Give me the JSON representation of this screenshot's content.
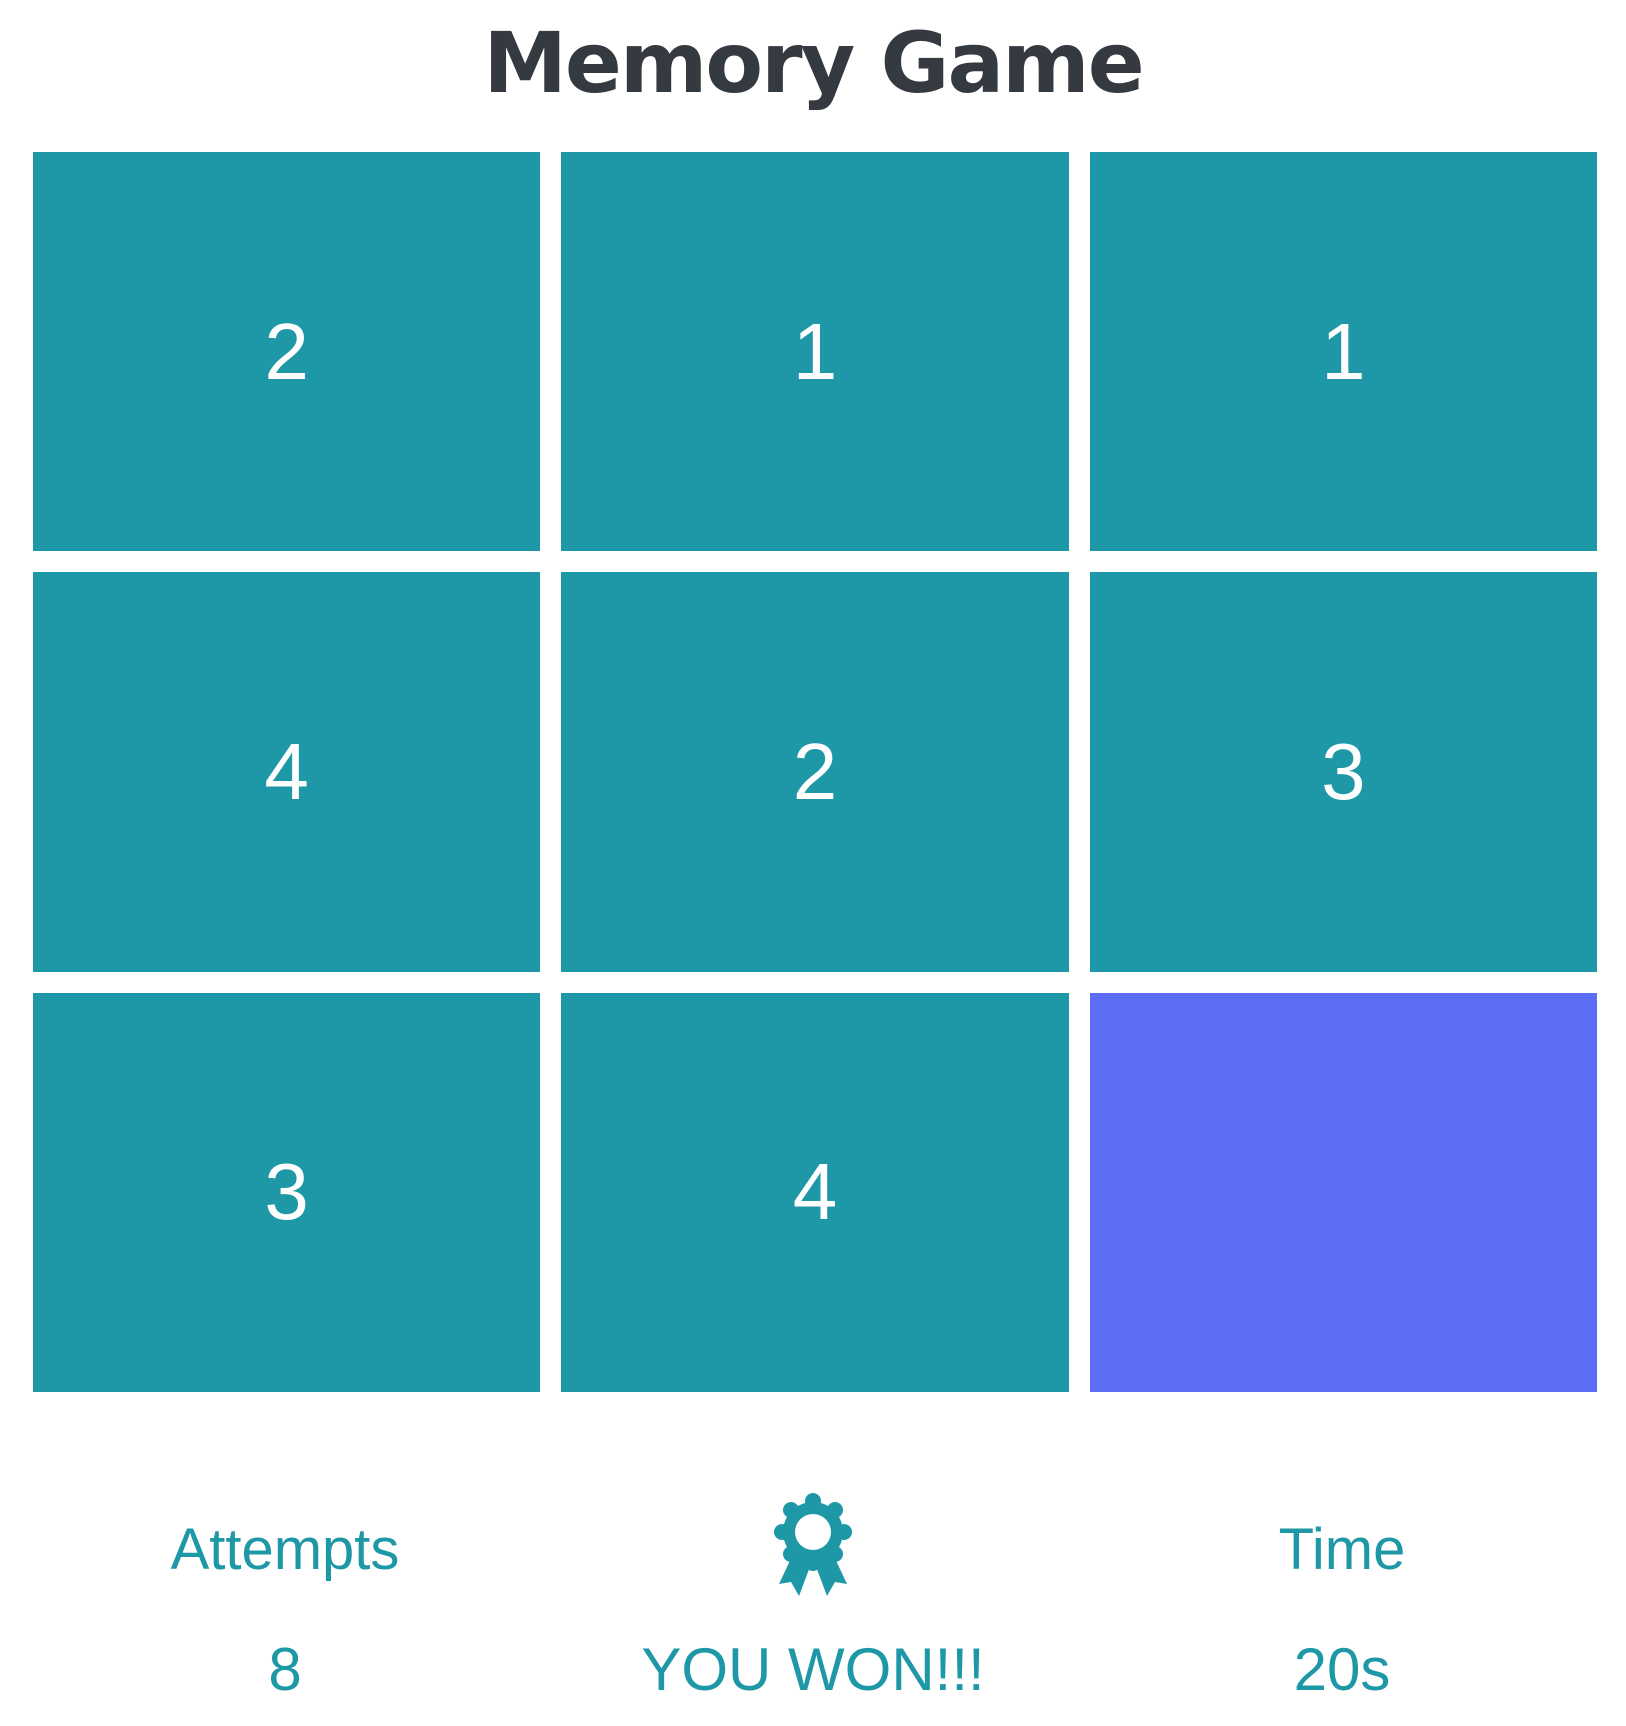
{
  "title": "Memory Game",
  "board": {
    "cards": [
      {
        "value": "2",
        "state": "revealed"
      },
      {
        "value": "1",
        "state": "revealed"
      },
      {
        "value": "1",
        "state": "revealed"
      },
      {
        "value": "4",
        "state": "revealed"
      },
      {
        "value": "2",
        "state": "revealed"
      },
      {
        "value": "3",
        "state": "revealed"
      },
      {
        "value": "3",
        "state": "revealed"
      },
      {
        "value": "4",
        "state": "revealed"
      },
      {
        "value": "",
        "state": "unrevealed"
      }
    ]
  },
  "stats": {
    "attempts_label": "Attempts",
    "attempts_value": "8",
    "status_icon": "award-icon",
    "status_text": "YOU WON!!!",
    "time_label": "Time",
    "time_value": "20s"
  },
  "colors": {
    "card_revealed": "#1e98a6",
    "card_unrevealed": "#5b6ef5",
    "accent": "#1e98a6",
    "title": "#343a40"
  }
}
